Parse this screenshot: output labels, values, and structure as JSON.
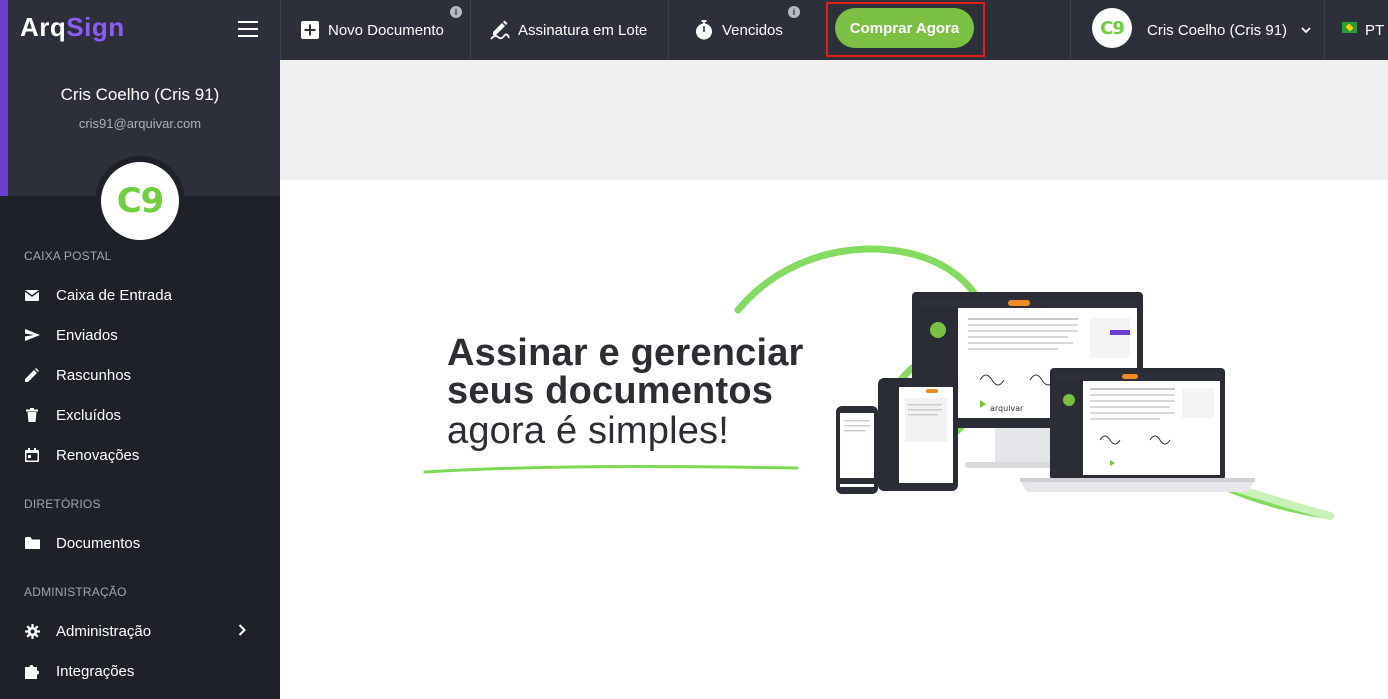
{
  "app": {
    "logo_prefix": "Arq",
    "logo_suffix": "Sign"
  },
  "user": {
    "name": "Cris Coelho (Cris 91)",
    "email": "cris91@arquivar.com",
    "initials": "C9"
  },
  "sidebar": {
    "sections": [
      {
        "title": "CAIXA POSTAL"
      },
      {
        "title": "DIRETÓRIOS"
      },
      {
        "title": "ADMINISTRAÇÃO"
      }
    ],
    "items": [
      {
        "label": "Caixa de Entrada",
        "icon": "mail-icon"
      },
      {
        "label": "Enviados",
        "icon": "send-icon"
      },
      {
        "label": "Rascunhos",
        "icon": "pencil-icon"
      },
      {
        "label": "Excluídos",
        "icon": "trash-icon"
      },
      {
        "label": "Renovações",
        "icon": "calendar-icon"
      },
      {
        "label": "Documentos",
        "icon": "folder-icon"
      },
      {
        "label": "Administração",
        "icon": "gear-icon"
      },
      {
        "label": "Integrações",
        "icon": "puzzle-icon"
      }
    ]
  },
  "topbar": {
    "new_document": "Novo Documento",
    "batch_signature": "Assinatura em Lote",
    "expired": "Vencidos",
    "buy_now": "Comprar Agora",
    "language": "PT",
    "info_glyph": "i"
  },
  "hero": {
    "line1": "Assinar e gerenciar",
    "line2": "seus documentos",
    "line3": "agora é simples!",
    "device_brand": "arquivar"
  },
  "colors": {
    "accent_purple": "#6b3fd1",
    "brand_green": "#7bc043",
    "sidebar_dark": "#1f2129",
    "topbar": "#2d2f3a",
    "highlight_red": "#e0201a"
  }
}
